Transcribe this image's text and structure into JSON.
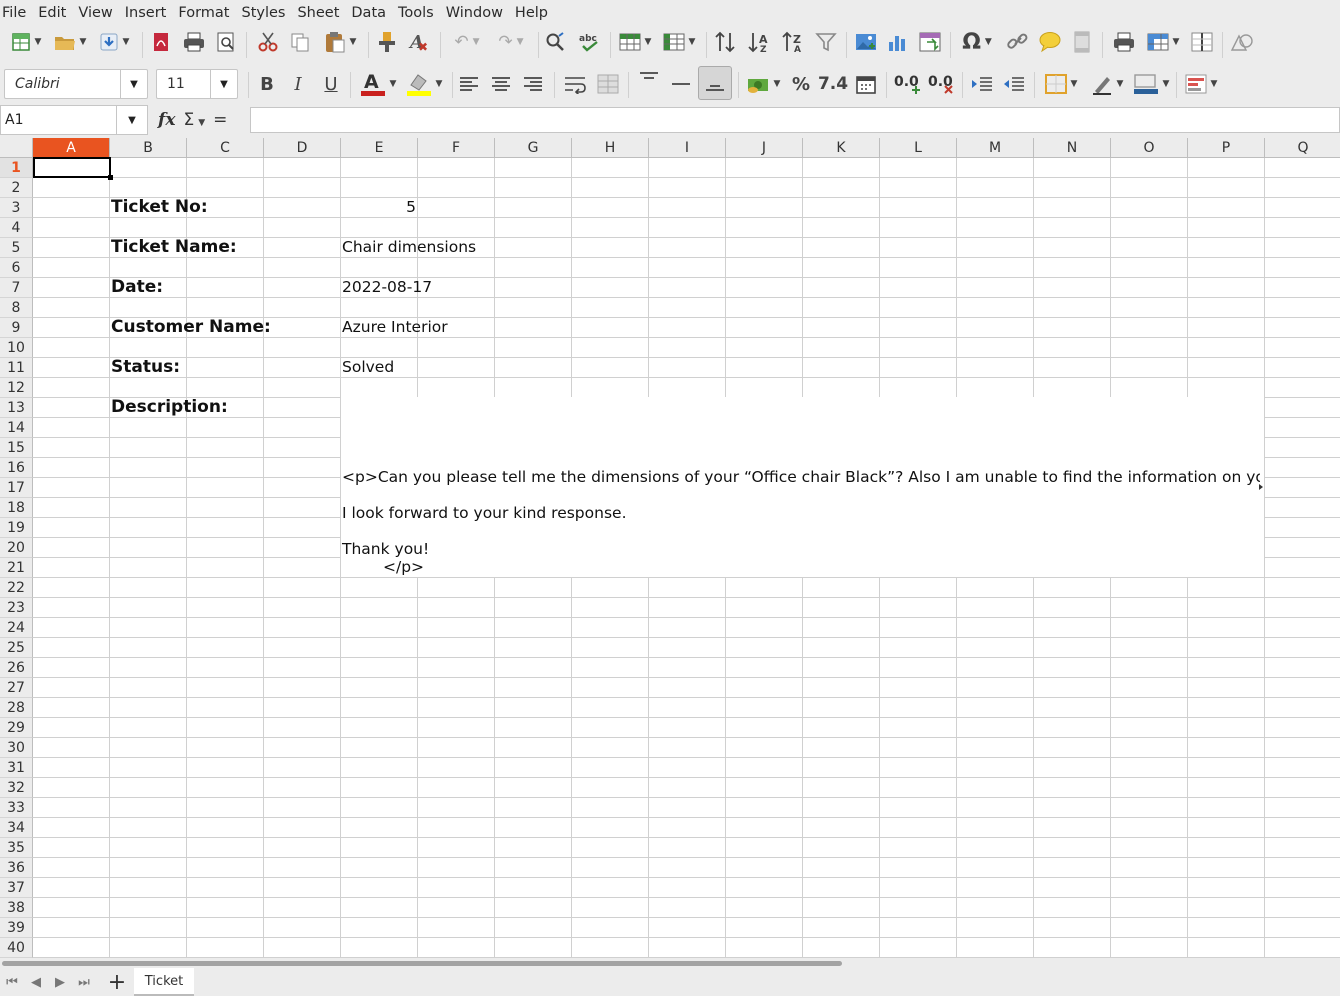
{
  "menu": [
    "File",
    "Edit",
    "View",
    "Insert",
    "Format",
    "Styles",
    "Sheet",
    "Data",
    "Tools",
    "Window",
    "Help"
  ],
  "font": {
    "name": "Calibri",
    "size": "11"
  },
  "namebox": {
    "value": "A1"
  },
  "formula": {
    "fx": "fx",
    "sigma": "Σ",
    "equals": "=",
    "content": ""
  },
  "columns": [
    "A",
    "B",
    "C",
    "D",
    "E",
    "F",
    "G",
    "H",
    "I",
    "J",
    "K",
    "L",
    "M",
    "N",
    "O",
    "P",
    "Q"
  ],
  "rows": [
    "1",
    "2",
    "3",
    "4",
    "5",
    "6",
    "7",
    "8",
    "9",
    "10",
    "11",
    "12",
    "13",
    "14",
    "15",
    "16",
    "17",
    "18",
    "19",
    "20",
    "21",
    "22",
    "23",
    "24",
    "25",
    "26",
    "27",
    "28",
    "29",
    "30",
    "31",
    "32",
    "33",
    "34",
    "35",
    "36",
    "37",
    "38",
    "39",
    "40"
  ],
  "selected_cell": "A1",
  "cells": {
    "ticket_no_label": "Ticket No:",
    "ticket_no_value": "5",
    "ticket_name_label": "Ticket Name:",
    "ticket_name_value": "Chair dimensions",
    "date_label": "Date:",
    "date_value": "2022-08-17",
    "customer_label": "Customer Name:",
    "customer_value": "Azure Interior",
    "status_label": "Status:",
    "status_value": "Solved",
    "description_label": "Description:",
    "description_line1": "<p>Can you please tell me the dimensions of your “Office chair Black”? Also I am unable to find the information on your",
    "description_line2": "I look forward to your kind response.",
    "description_line3": "Thank you!",
    "description_line4": "</p>"
  },
  "sheet_tabs": [
    "Ticket"
  ],
  "toolbar_icons": [
    "new-icon",
    "open-icon",
    "save-icon",
    "export-pdf-icon",
    "print-icon",
    "print-preview-icon",
    "cut-icon",
    "copy-icon",
    "paste-icon",
    "clone-format-icon",
    "clear-format-icon",
    "undo-icon",
    "redo-icon",
    "find-replace-icon",
    "spelling-icon",
    "row-icon",
    "column-icon",
    "sort-icon",
    "sort-ascending-icon",
    "sort-descending-icon",
    "autofilter-icon",
    "image-icon",
    "chart-icon",
    "pivot-table-icon",
    "special-character-icon",
    "hyperlink-icon",
    "comment-icon",
    "header-footer-icon",
    "print-area-icon",
    "freeze-icon",
    "split-window-icon",
    "shapes-icon"
  ]
}
